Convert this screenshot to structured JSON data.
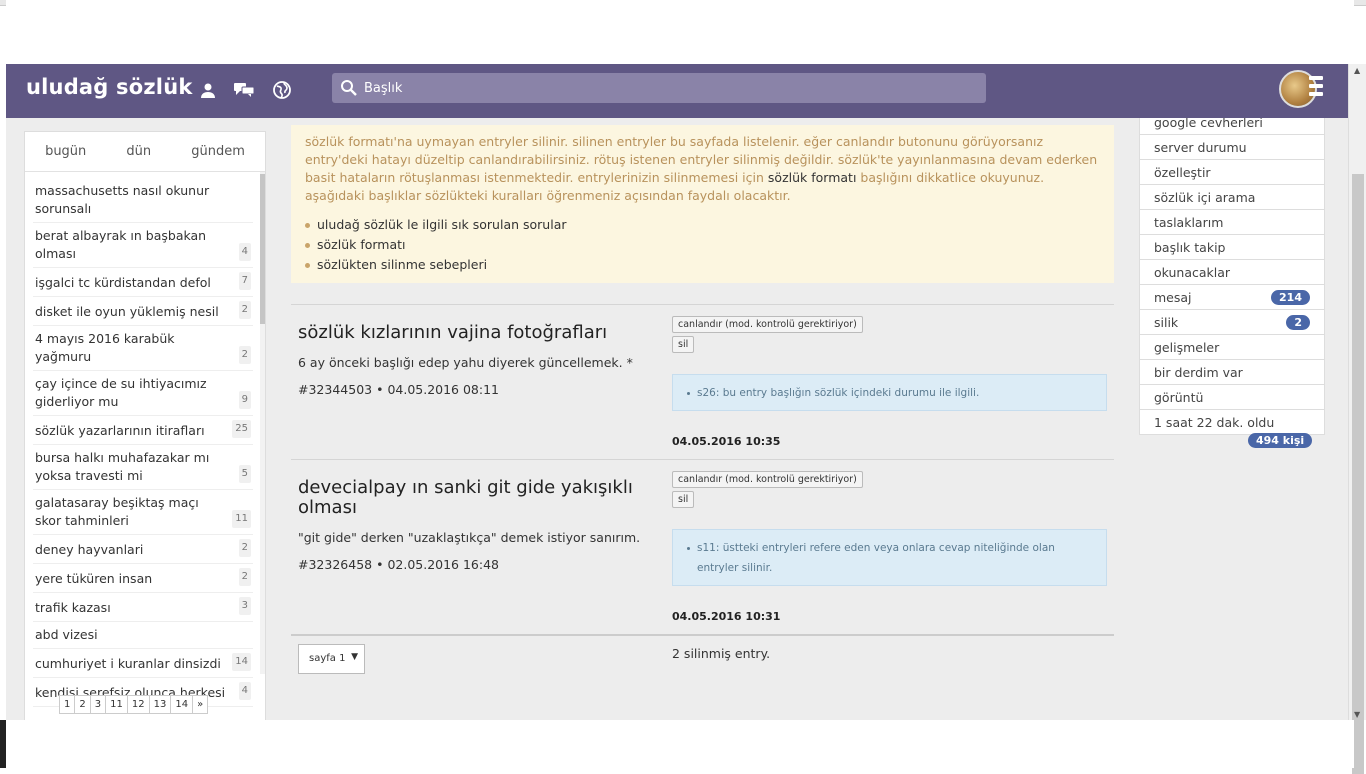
{
  "header": {
    "logo": "uludağ sözlük",
    "search_placeholder": "Başlık"
  },
  "left": {
    "tabs": [
      "bugün",
      "dün",
      "gündem"
    ],
    "topics": [
      {
        "title": "massachusetts nasıl okunur sorunsalı",
        "count": ""
      },
      {
        "title": "berat albayrak ın başbakan olması",
        "count": "4"
      },
      {
        "title": "işgalci tc kürdistandan defol",
        "count": "7"
      },
      {
        "title": "disket ile oyun yüklemiş nesil",
        "count": "2"
      },
      {
        "title": "4 mayıs 2016 karabük yağmuru",
        "count": "2"
      },
      {
        "title": "çay içince de su ihtiyacımız giderliyor mu",
        "count": "9"
      },
      {
        "title": "sözlük yazarlarının itirafları",
        "count": "25"
      },
      {
        "title": "bursa halkı muhafazakar mı yoksa travesti mi",
        "count": "5"
      },
      {
        "title": "galatasaray beşiktaş maçı skor tahminleri",
        "count": "11"
      },
      {
        "title": "deney hayvanlari",
        "count": "2"
      },
      {
        "title": "yere tüküren insan",
        "count": "2"
      },
      {
        "title": "trafik kazası",
        "count": "3"
      },
      {
        "title": "abd vizesi",
        "count": ""
      },
      {
        "title": "cumhuriyet i kuranlar dinsizdi",
        "count": "14"
      },
      {
        "title": "kendisi şerefsiz olunca herkesi",
        "count": "4"
      }
    ],
    "pager": [
      "1",
      "2",
      "3",
      "11",
      "12",
      "13",
      "14",
      "»"
    ]
  },
  "notice": {
    "p1": "sözlük formatı'na uymayan entryler silinir. silinen entryler bu sayfada listelenir. eğer canlandır butonunu görüyorsanız entry'deki hatayı düzeltip canlandırabilirsiniz. rötuş istenen entryler silinmiş değildir. sözlük'te yayınlanmasına devam ederken basit hataların rötuşlanması istenmektedir. entrylerinizin silinmemesi için",
    "link": "sözlük formatı",
    "p2": "başlığını dikkatlice okuyunuz. aşağıdaki başlıklar sözlükteki kuralları öğrenmeniz açısından faydalı olacaktır.",
    "links": [
      "uludağ sözlük le ilgili sık sorulan sorular",
      "sözlük formatı",
      "sözlükten silinme sebepleri"
    ]
  },
  "entries": [
    {
      "title": "sözlük kızlarının vajina fotoğrafları",
      "text": "6 ay önceki başlığı edep yahu diyerek güncellemek. *",
      "id": "#32344503",
      "date": "04.05.2016 08:11",
      "revive": "canlandır (mod. kontrolü gerektiriyor)",
      "delete": "sil",
      "reason": "s26: bu entry başlığın sözlük içindeki durumu ile ilgili.",
      "deleted_at": "04.05.2016 10:35"
    },
    {
      "title": "devecialpay ın sanki git gide yakışıklı olması",
      "text": "\"git gide\" derken \"uzaklaştıkça\" demek istiyor sanırım.",
      "id": "#32326458",
      "date": "02.05.2016 16:48",
      "revive": "canlandır (mod. kontrolü gerektiriyor)",
      "delete": "sil",
      "reason": "s11: üstteki entryleri refere eden veya onlara cevap niteliğinde olan entryler silinir.",
      "deleted_at": "04.05.2016 10:31"
    }
  ],
  "page_select": "sayfa 1",
  "deleted_count": "2 silinmiş entry.",
  "right": {
    "items": [
      {
        "label": "google cevherleri",
        "badge": ""
      },
      {
        "label": "server durumu",
        "badge": ""
      },
      {
        "label": "özelleştir",
        "badge": ""
      },
      {
        "label": "sözlük içi arama",
        "badge": ""
      },
      {
        "label": "taslaklarım",
        "badge": ""
      },
      {
        "label": "başlık takip",
        "badge": ""
      },
      {
        "label": "okunacaklar",
        "badge": ""
      },
      {
        "label": "mesaj",
        "badge": "214"
      },
      {
        "label": "silik",
        "badge": "2"
      },
      {
        "label": "gelişmeler",
        "badge": ""
      },
      {
        "label": "bir derdim var",
        "badge": ""
      },
      {
        "label": "görüntü",
        "badge": ""
      },
      {
        "label": "1 saat 22 dak. oldu",
        "badge": ""
      }
    ],
    "online": "494 kişi"
  }
}
